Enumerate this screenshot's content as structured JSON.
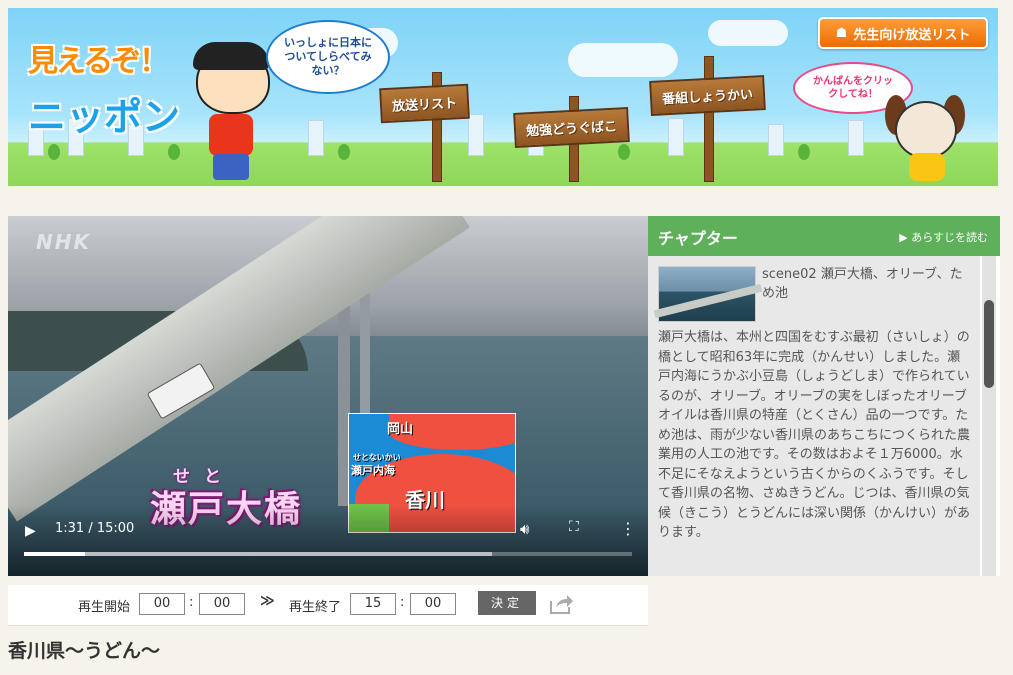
{
  "banner": {
    "logo_line1": "見えるぞ！",
    "logo_line2": "ニッポン",
    "speech_boy": "いっしょに日本についてしらべてみない？",
    "speech_dog": "かんばんをクリックしてね！",
    "teacher_button": "先生向け放送リスト",
    "signs": [
      "放送リスト",
      "勉強どうぐばこ",
      "番組しょうかい"
    ]
  },
  "video": {
    "watermark": "NHK",
    "caption_ruby": "せと",
    "caption_main": "瀬戸大橋",
    "map_labels": {
      "okayama": "岡山",
      "setonaikai_ruby": "せとないかい",
      "setonaikai": "瀬戸内海",
      "kagawa": "香川"
    },
    "time_display": "1:31 / 15:00",
    "progress": {
      "played_fraction": 0.1,
      "buffered_fraction": 0.77
    }
  },
  "range": {
    "start_label": "再生開始",
    "start_min": "00",
    "start_sec": "00",
    "arrow": "≫",
    "end_label": "再生終了",
    "end_min": "15",
    "end_sec": "00",
    "decide_label": "決定"
  },
  "page_title": "香川県〜うどん〜",
  "chapter": {
    "heading": "チャプター",
    "read_summary": "▶ あらすじを読む",
    "scene_title": "scene02 瀬戸大橋、オリーブ、ため池",
    "description": "瀬戸大橋は、本州と四国をむすぶ最初（さいしょ）の橋として昭和63年に完成（かんせい）しました。瀬戸内海にうかぶ小豆島（しょうどしま）で作られているのが、オリーブ。オリーブの実をしぼったオリーブオイルは香川県の特産（とくさん）品の一つです。ため池は、雨が少ない香川県のあちこちにつくられた農業用の人工の池です。その数はおよそ１万6000。水不足にそなえようという古くからのくふうです。そして香川県の名物、さぬきうどん。じつは、香川県の気候（きこう）とうどんには深い関係（かんけい）があります。"
  }
}
